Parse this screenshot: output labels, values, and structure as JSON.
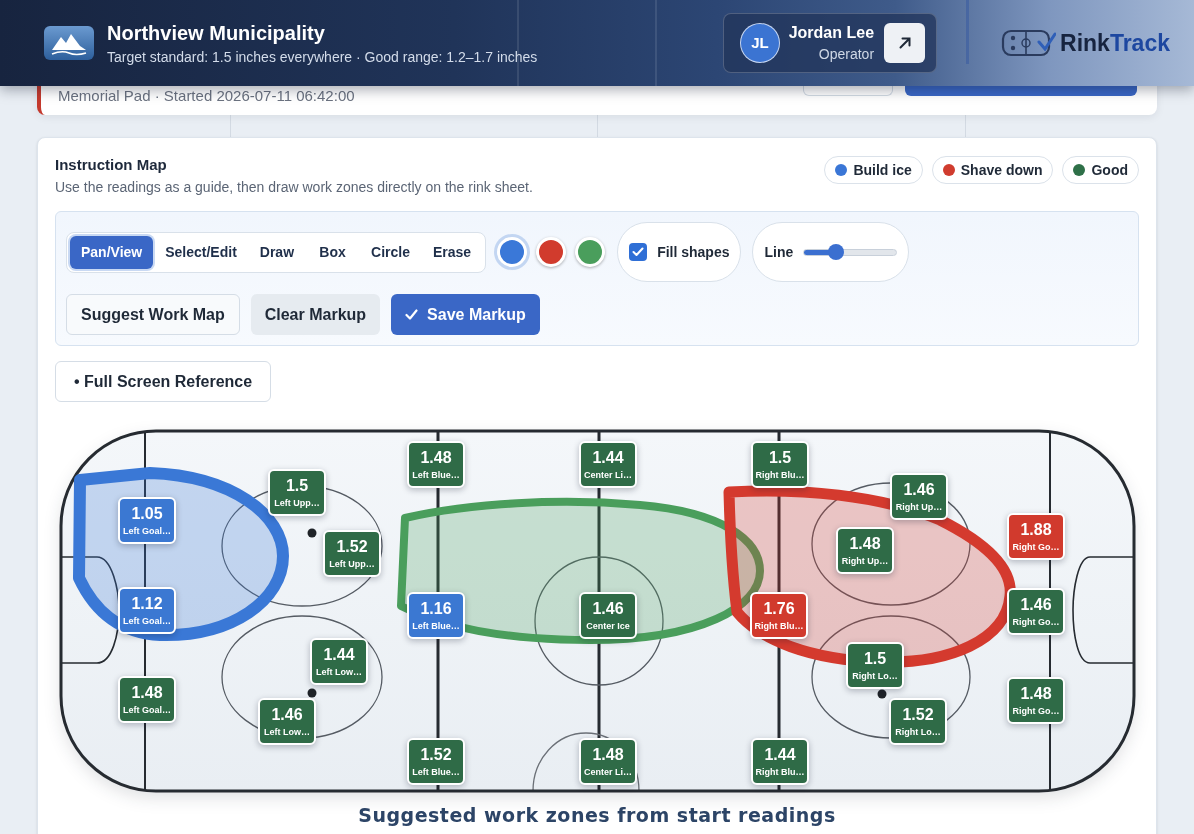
{
  "header": {
    "org_name": "Northview Municipality",
    "subtitle": "Target standard: 1.5 inches everywhere · Good range: 1.2–1.7 inches",
    "user": {
      "initials": "JL",
      "name": "Jordan Lee",
      "role": "Operator"
    },
    "brand": {
      "first": "Rink",
      "second": "Track"
    }
  },
  "session_card": {
    "subtitle": "Memorial Pad · Started 2026-07-11 06:42:00"
  },
  "instruction_map": {
    "title": "Instruction Map",
    "description": "Use the readings as a guide, then draw work zones directly on the rink sheet.",
    "legend": [
      {
        "label": "Build ice",
        "color": "#3a76d6"
      },
      {
        "label": "Shave down",
        "color": "#d03c2e"
      },
      {
        "label": "Good",
        "color": "#2e7048"
      }
    ],
    "tools": [
      {
        "label": "Pan/View",
        "selected": true
      },
      {
        "label": "Select/Edit",
        "selected": false
      },
      {
        "label": "Draw",
        "selected": false
      },
      {
        "label": "Box",
        "selected": false
      },
      {
        "label": "Circle",
        "selected": false
      },
      {
        "label": "Erase",
        "selected": false
      }
    ],
    "swatches": [
      {
        "color": "#3a78d8",
        "selected": true
      },
      {
        "color": "#d13b2d",
        "selected": false
      },
      {
        "color": "#4a9e5c",
        "selected": false
      }
    ],
    "fill_shapes": {
      "label": "Fill shapes",
      "checked": true
    },
    "line": {
      "label": "Line",
      "level": 0.35
    },
    "actions": [
      {
        "label": "Suggest Work Map",
        "kind": "outline"
      },
      {
        "label": "Clear Markup",
        "kind": "muted"
      },
      {
        "label": "Save Markup",
        "kind": "primary"
      }
    ],
    "full_screen": {
      "icon": "•",
      "label": "Full Screen Reference"
    },
    "rink": {
      "markup_zones": [
        {
          "color": "#3a78d6"
        },
        {
          "color": "#4a9e5c"
        },
        {
          "color": "#d43a2e"
        }
      ],
      "readings": [
        {
          "value": "1.48",
          "name": "Left Blue…",
          "color": "#2f6b47"
        },
        {
          "value": "1.44",
          "name": "Center Li…",
          "color": "#2f6b47"
        },
        {
          "value": "1.5",
          "name": "Right Blu…",
          "color": "#2f6b47"
        },
        {
          "value": "1.5",
          "name": "Left Upp…",
          "color": "#2f6b47"
        },
        {
          "value": "1.46",
          "name": "Right Up…",
          "color": "#2f6b47"
        },
        {
          "value": "1.05",
          "name": "Left Goal…",
          "color": "#3b78d2"
        },
        {
          "value": "1.88",
          "name": "Right Go…",
          "color": "#d13a2d"
        },
        {
          "value": "1.52",
          "name": "Left Upp…",
          "color": "#2f6b47"
        },
        {
          "value": "1.48",
          "name": "Right Up…",
          "color": "#2f6b47"
        },
        {
          "value": "1.12",
          "name": "Left Goal…",
          "color": "#3b78d2"
        },
        {
          "value": "1.16",
          "name": "Left Blue…",
          "color": "#3b78d2"
        },
        {
          "value": "1.46",
          "name": "Center Ice",
          "color": "#2f6b47"
        },
        {
          "value": "1.76",
          "name": "Right Blu…",
          "color": "#d13a2d"
        },
        {
          "value": "1.46",
          "name": "Right Go…",
          "color": "#2f6b47"
        },
        {
          "value": "1.44",
          "name": "Left Low…",
          "color": "#2f6b47"
        },
        {
          "value": "1.5",
          "name": "Right Lo…",
          "color": "#2f6b47"
        },
        {
          "value": "1.48",
          "name": "Left Goal…",
          "color": "#2f6b47"
        },
        {
          "value": "1.48",
          "name": "Right Go…",
          "color": "#2f6b47"
        },
        {
          "value": "1.46",
          "name": "Left Low…",
          "color": "#2f6b47"
        },
        {
          "value": "1.52",
          "name": "Right Lo…",
          "color": "#2f6b47"
        },
        {
          "value": "1.52",
          "name": "Left Blue…",
          "color": "#2f6b47"
        },
        {
          "value": "1.48",
          "name": "Center Li…",
          "color": "#2f6b47"
        },
        {
          "value": "1.44",
          "name": "Right Blu…",
          "color": "#2f6b47"
        }
      ],
      "caption": "Suggested work zones from start readings"
    }
  }
}
